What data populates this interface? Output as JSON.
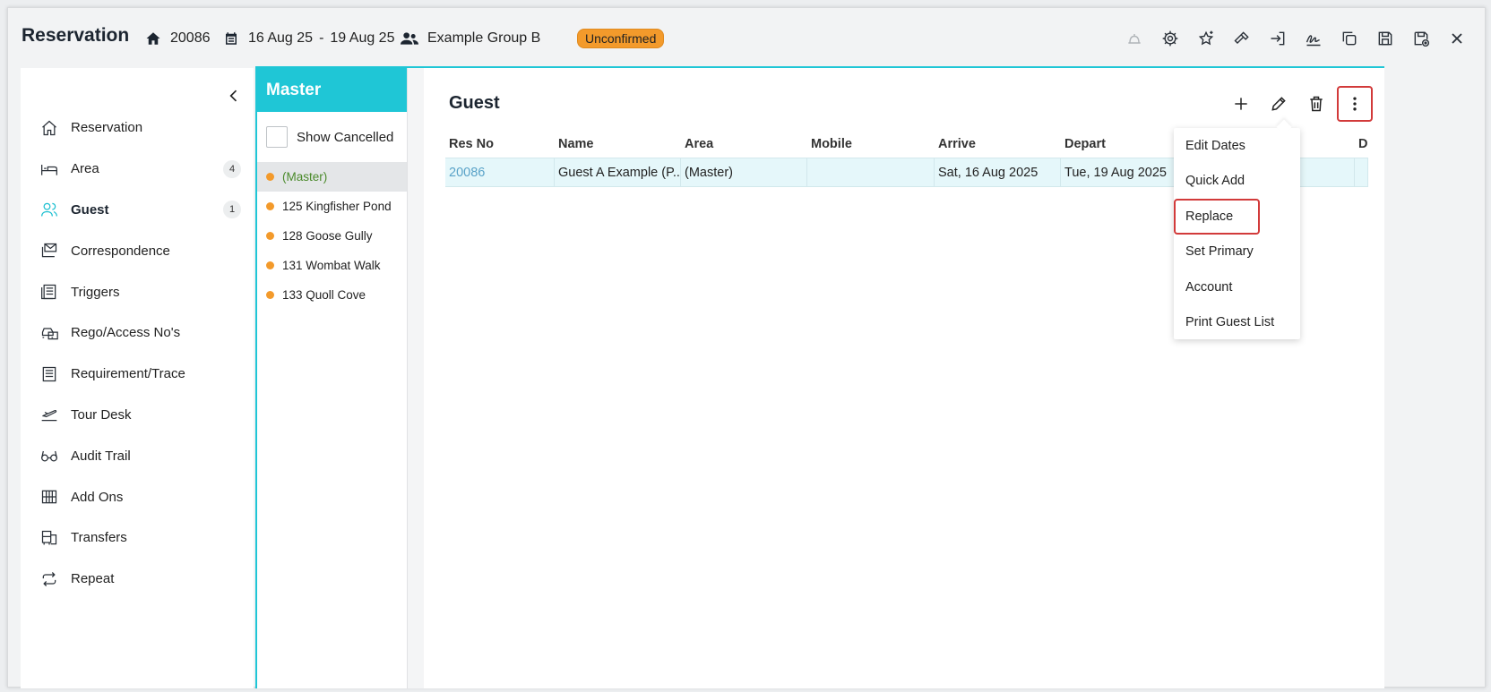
{
  "header": {
    "title": "Reservation",
    "res_no": "20086",
    "date_from": "16 Aug 25",
    "date_sep": "-",
    "date_to": "19 Aug 25",
    "group": "Example Group B",
    "status": "Unconfirmed",
    "status_color": "#f39a2b",
    "toolbar_icons": [
      "bell-icon",
      "gear-icon",
      "sparkle-star-icon",
      "hammer-icon",
      "sign-in-icon",
      "signature-icon",
      "copy-icon",
      "save-icon",
      "save-close-icon",
      "close-icon"
    ]
  },
  "sidebar": {
    "items": [
      {
        "label": "Reservation",
        "icon": "home-icon",
        "count": ""
      },
      {
        "label": "Area",
        "icon": "bed-icon",
        "count": "4"
      },
      {
        "label": "Guest",
        "icon": "users-icon",
        "count": "1",
        "active": true
      },
      {
        "label": "Correspondence",
        "icon": "mail-stack-icon",
        "count": ""
      },
      {
        "label": "Triggers",
        "icon": "document-icon",
        "count": ""
      },
      {
        "label": "Rego/Access No's",
        "icon": "car-icon",
        "count": ""
      },
      {
        "label": "Requirement/Trace",
        "icon": "list-icon",
        "count": ""
      },
      {
        "label": "Tour Desk",
        "icon": "plane-icon",
        "count": ""
      },
      {
        "label": "Audit Trail",
        "icon": "glasses-icon",
        "count": ""
      },
      {
        "label": "Add Ons",
        "icon": "abacus-icon",
        "count": ""
      },
      {
        "label": "Transfers",
        "icon": "bus-icon",
        "count": ""
      },
      {
        "label": "Repeat",
        "icon": "repeat-icon",
        "count": ""
      }
    ]
  },
  "areas": {
    "title": "Master",
    "show_cancelled": "Show Cancelled",
    "items": [
      "(Master)",
      "125 Kingfisher Pond",
      "128 Goose Gully",
      "131 Wombat Walk",
      "133 Quoll Cove"
    ]
  },
  "guest": {
    "title": "Guest",
    "columns": [
      "Res No",
      "Name",
      "Area",
      "Mobile",
      "Arrive",
      "Depart",
      "",
      "D"
    ],
    "rows": [
      [
        "20086",
        "Guest A Example (P...",
        "(Master)",
        "",
        "Sat, 16 Aug 2025",
        "Tue, 19 Aug 2025",
        "",
        ""
      ]
    ]
  },
  "menu": {
    "items": [
      "Edit Dates",
      "Quick Add",
      "Replace",
      "Set Primary",
      "Account",
      "Print Guest List"
    ]
  },
  "colors": {
    "accent": "#1fc6d6",
    "highlight": "#d23a3a",
    "dot": "#f39a2b"
  }
}
